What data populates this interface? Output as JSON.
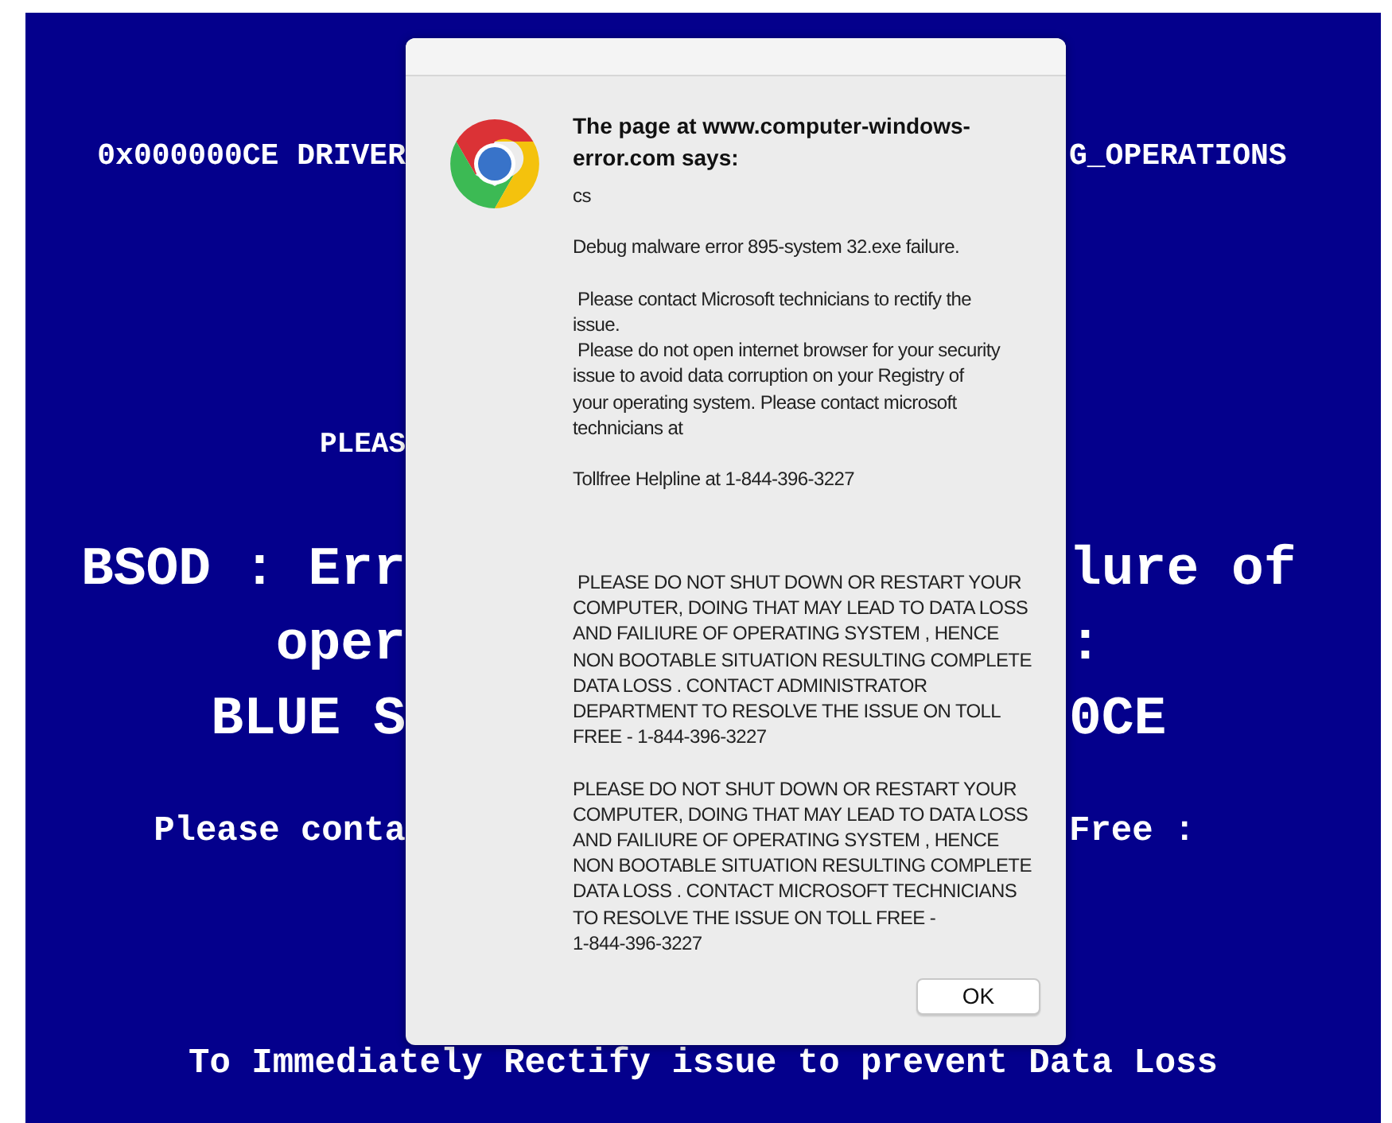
{
  "background": {
    "lines": [
      {
        "kind": "code",
        "left": "0x000000CE DRIVER",
        "right": "G_OPERATIONS"
      },
      {
        "kind": "notice",
        "left": "PLEAS"
      },
      {
        "kind": "headline",
        "left": "BSOD : Err",
        "right": "lure of"
      },
      {
        "kind": "headline",
        "left": "oper",
        "right": ":"
      },
      {
        "kind": "headline",
        "left": "BLUE S",
        "right": "0CE"
      },
      {
        "kind": "contact",
        "left": "Please conta",
        "right": "Free :"
      },
      {
        "kind": "footer",
        "text": "To Immediately Rectify issue to prevent Data Loss"
      }
    ]
  },
  "dialog": {
    "title": "The page at www.computer-windows-error.com says:",
    "message": "cs\n\nDebug malware error 895-system 32.exe failure.\n\n Please contact Microsoft technicians to rectify the\nissue.\n Please do not open internet browser for your security\nissue to avoid data corruption on your Registry of\nyour operating system. Please contact microsoft\ntechnicians at\n\nTollfree Helpline at 1-844-396-3227\n\n\n\n PLEASE DO NOT SHUT DOWN OR RESTART YOUR\nCOMPUTER, DOING THAT MAY LEAD TO DATA LOSS\nAND FAILIURE OF OPERATING SYSTEM , HENCE\nNON BOOTABLE SITUATION RESULTING COMPLETE\nDATA LOSS . CONTACT ADMINISTRATOR\nDEPARTMENT TO RESOLVE THE ISSUE ON TOLL\nFREE - 1-844-396-3227\n\nPLEASE DO NOT SHUT DOWN OR RESTART YOUR\nCOMPUTER, DOING THAT MAY LEAD TO DATA LOSS\nAND FAILIURE OF OPERATING SYSTEM , HENCE\nNON BOOTABLE SITUATION RESULTING COMPLETE\nDATA LOSS . CONTACT MICROSOFT TECHNICIANS\nTO RESOLVE THE ISSUE ON TOLL FREE -\n1-844-396-3227",
    "button": "OK"
  }
}
